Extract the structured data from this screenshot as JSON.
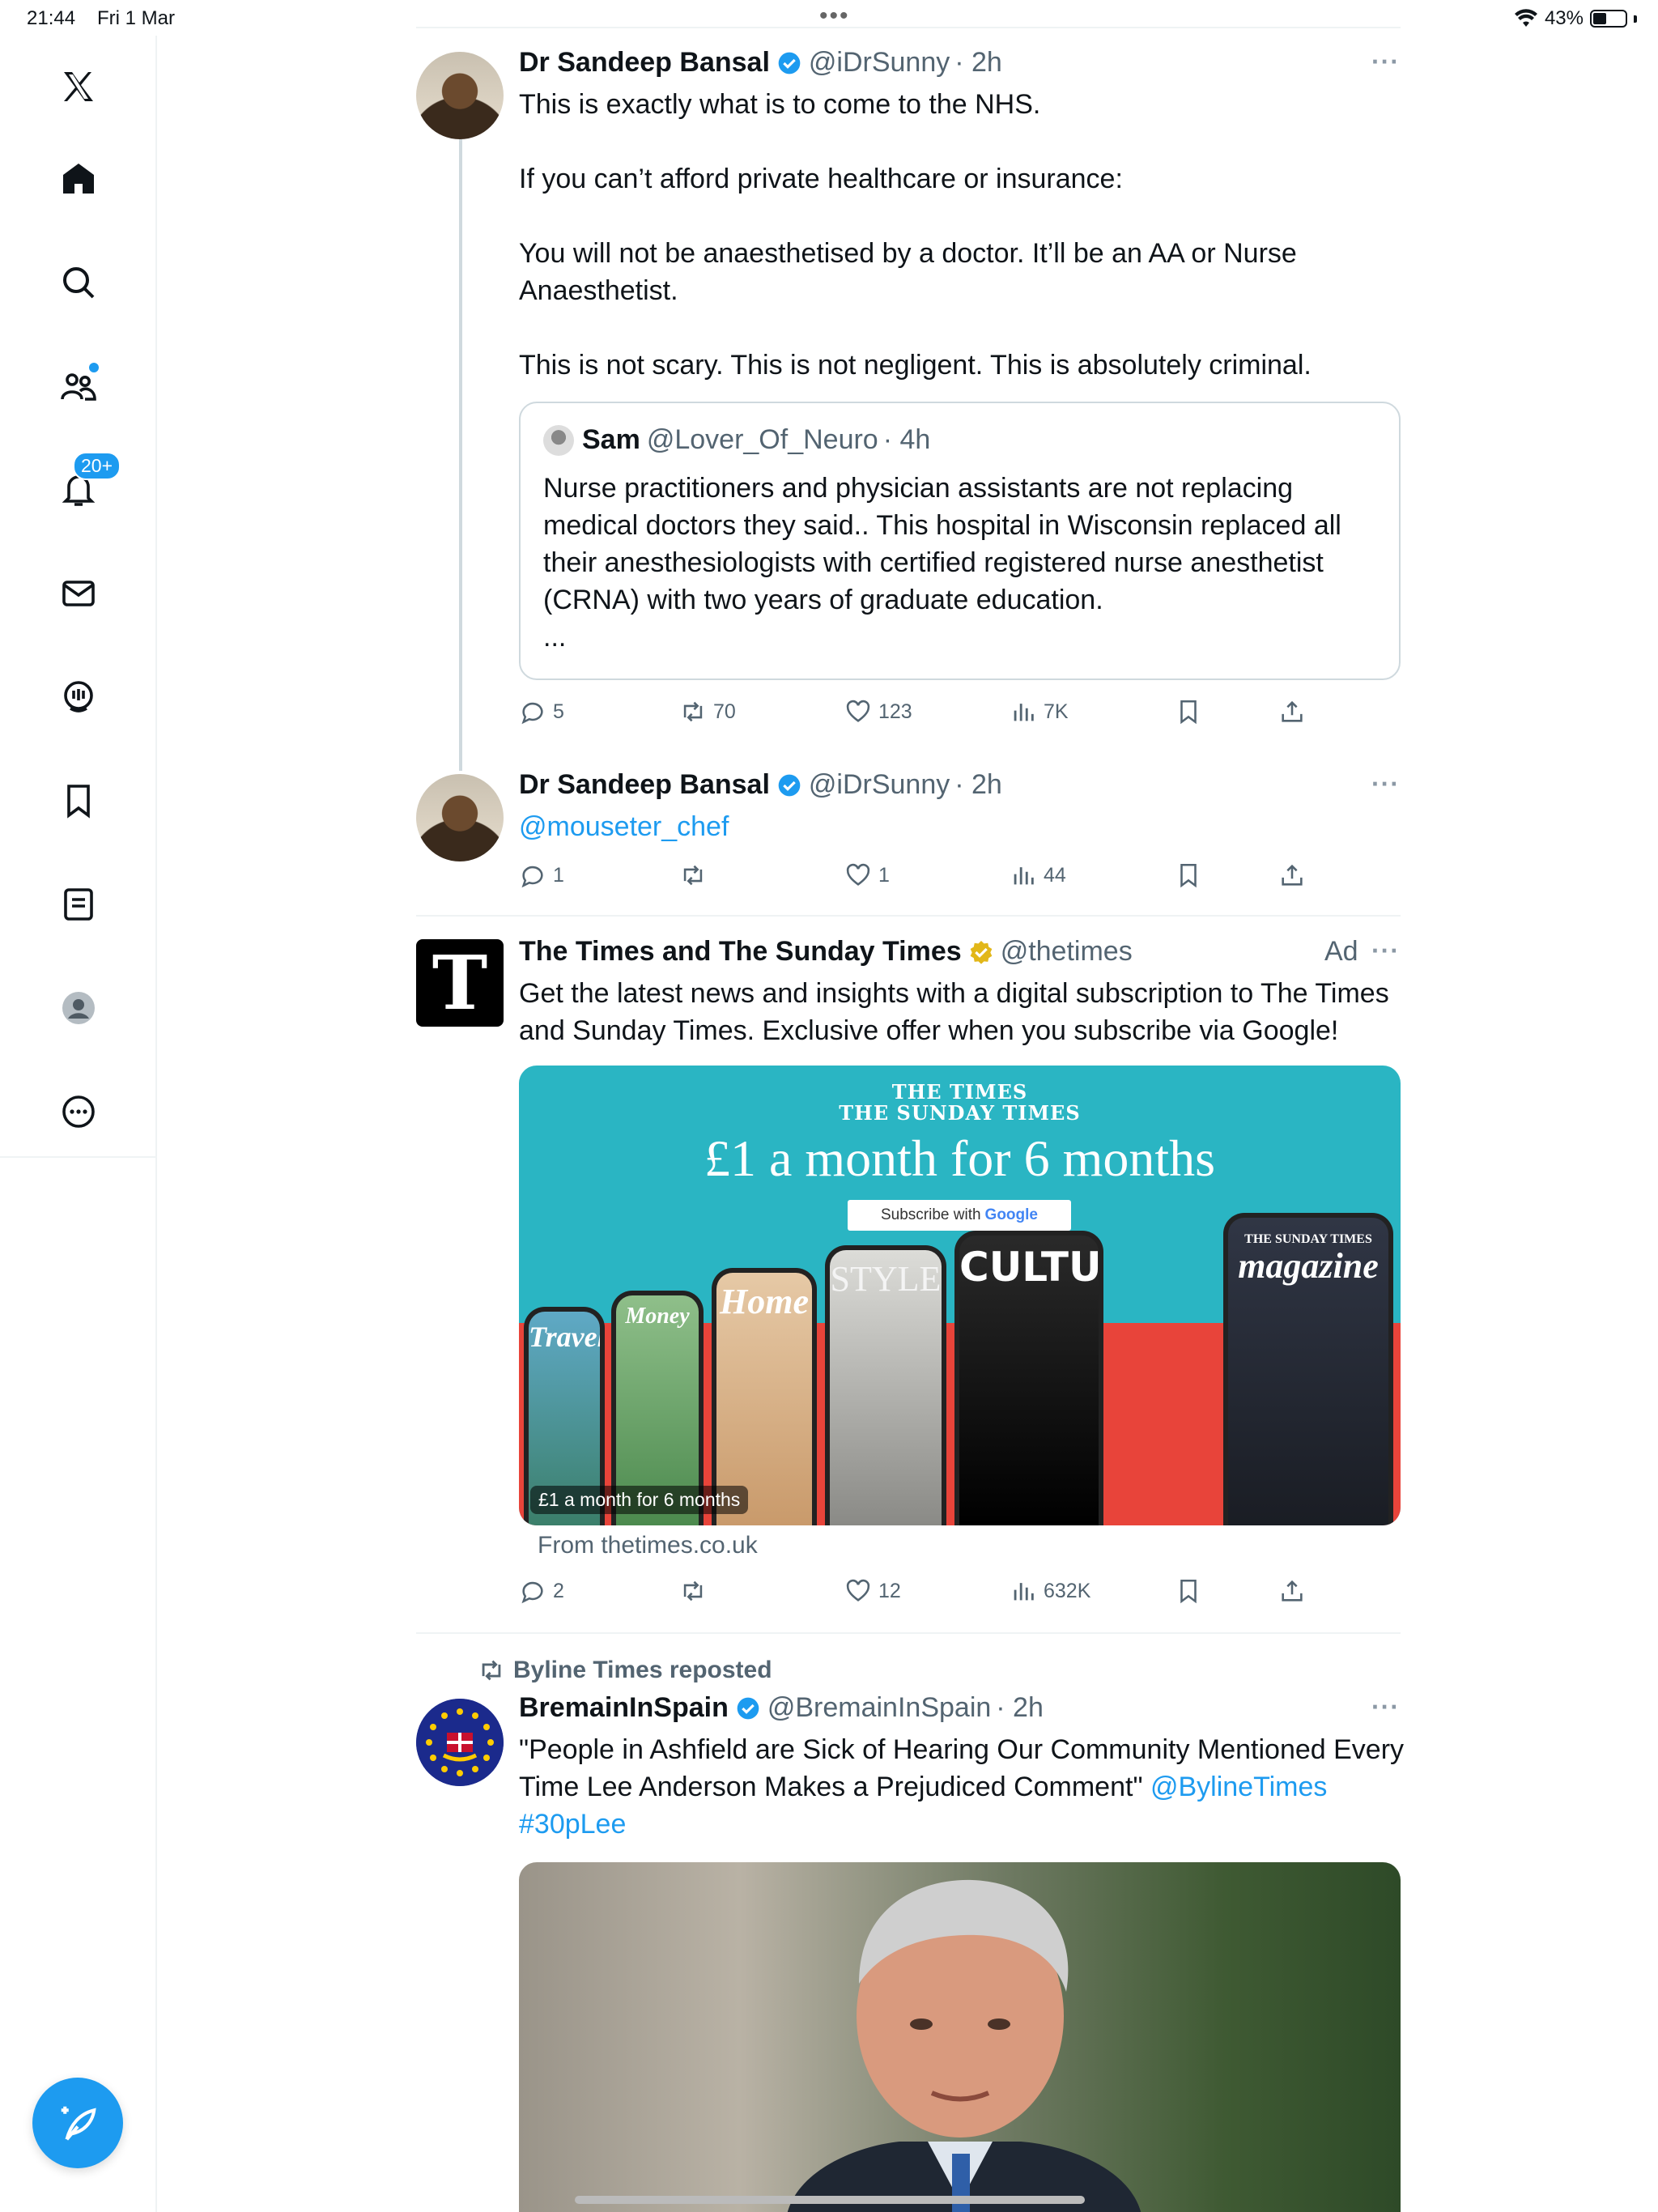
{
  "status": {
    "time": "21:44",
    "date": "Fri 1 Mar",
    "battery": "43%",
    "battery_level": 0.43
  },
  "sidebar": {
    "items": [
      {
        "name": "x-logo"
      },
      {
        "name": "home"
      },
      {
        "name": "search"
      },
      {
        "name": "communities"
      },
      {
        "name": "notifications",
        "badge": "20+"
      },
      {
        "name": "messages"
      },
      {
        "name": "spaces"
      },
      {
        "name": "bookmarks"
      },
      {
        "name": "lists"
      },
      {
        "name": "profile"
      },
      {
        "name": "more"
      }
    ],
    "compose_icon": "compose-feather-icon"
  },
  "tweets": [
    {
      "name": "Dr Sandeep Bansal",
      "handle": "@iDrSunny",
      "time": "· 2h",
      "paragraphs": [
        "This is exactly what is to come to the NHS.",
        "If you can’t afford private healthcare or insurance:",
        "You will not be anaesthetised by a doctor. It’ll be an AA or Nurse Anaesthetist.",
        "This is not scary. This is not negligent. This is absolutely criminal."
      ],
      "quote": {
        "name": "Sam",
        "handle": "@Lover_Of_Neuro",
        "time": "· 4h",
        "text": "Nurse practitioners and physician assistants are not replacing medical doctors they said.. This hospital in Wisconsin replaced all their anesthesiologists with certified registered nurse anesthetist (CRNA) with two years of graduate education.",
        "ellipsis": "..."
      },
      "stats": {
        "replies": "5",
        "reposts": "70",
        "likes": "123",
        "views": "7K"
      }
    },
    {
      "name": "Dr Sandeep Bansal",
      "handle": "@iDrSunny",
      "time": "· 2h",
      "mention": "@mouseter_chef",
      "stats": {
        "replies": "1",
        "reposts": "",
        "likes": "1",
        "views": "44"
      }
    },
    {
      "name": "The Times and The Sunday Times",
      "handle": "@thetimes",
      "ad_label": "Ad",
      "logo_letter": "T",
      "text": "Get the latest news and insights with a digital subscription to The Times and Sunday Times. Exclusive offer when you subscribe via Google!",
      "card": {
        "brand_line1": "THE TIMES",
        "brand_line2": "THE SUNDAY TIMES",
        "headline": "£1 a month for 6 months",
        "subscribe_text": "Subscribe with",
        "subscribe_google": "Google",
        "phones": [
          "Travel",
          "Money",
          "Home",
          "STYLE",
          "CULTURE",
          "magazine"
        ],
        "magazine_top": "THE SUNDAY TIMES",
        "caption": "£1 a month for 6 months",
        "colors": {
          "teal": "#2ab5c3",
          "red": "#e8443a"
        }
      },
      "from": "From thetimes.co.uk",
      "stats": {
        "replies": "2",
        "reposts": "",
        "likes": "12",
        "views": "632K"
      }
    },
    {
      "reposted_by": "Byline Times reposted",
      "name": "BremainInSpain",
      "handle": "@BremainInSpain",
      "time": "· 2h",
      "text_plain": "\"People in Ashfield are Sick of Hearing Our Community Mentioned Every Time Lee Anderson Makes a Prejudiced Comment\"",
      "mention": "@BylineTimes",
      "hashtag": "#30pLee"
    }
  ],
  "colors": {
    "accent": "#1d9bf0",
    "text": "#0f1419",
    "muted": "#536471",
    "border": "#eff3f4",
    "ad_verified": "#e2b719"
  }
}
